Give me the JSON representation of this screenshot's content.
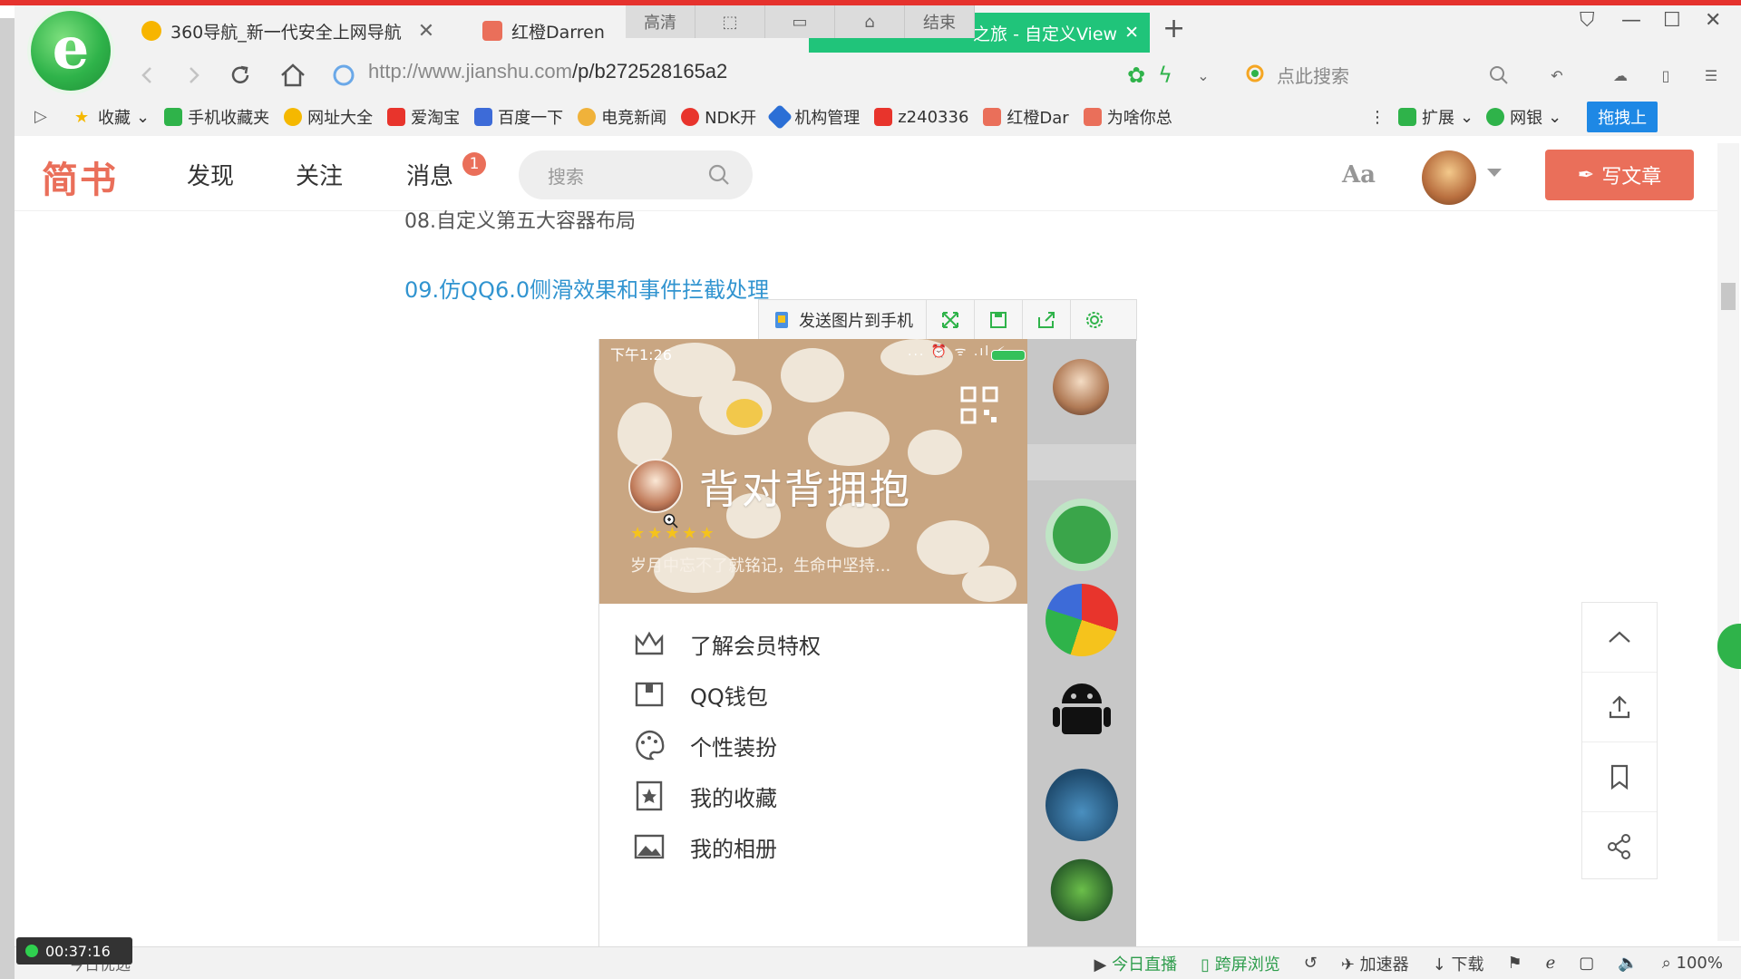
{
  "browser": {
    "tabs": [
      {
        "label": "360导航_新一代安全上网导航",
        "close": "✕"
      },
      {
        "label": "红橙Darren"
      }
    ],
    "overlay_tools": [
      "高清",
      "",
      "",
      "",
      "结束"
    ],
    "active_tab": {
      "label": "之旅 - 自定义View",
      "close": "✕"
    },
    "new_tab": "+",
    "url_host": "http://www.jianshu.com",
    "url_path": "/p/b272528165a2",
    "search_placeholder": "点此搜索",
    "bookmarks": [
      "收藏",
      "手机收藏夹",
      "网址大全",
      "爱淘宝",
      "百度一下",
      "电竞新闻",
      "NDK开",
      "机构管理",
      "z240336",
      "红橙Dar",
      "为啥你总"
    ],
    "bookmarks_right": {
      "extensions": "扩展",
      "netbank": "网银",
      "drag": "拖拽上"
    },
    "colors": {
      "accent": "#e5322d",
      "active_tab": "#20c47a"
    }
  },
  "site": {
    "brand": "简书",
    "nav": [
      "发现",
      "关注",
      "消息"
    ],
    "message_badge": "1",
    "search_placeholder": "搜索",
    "font_toggle": "Aa",
    "write_button": "写文章",
    "brand_color": "#ea6f5a"
  },
  "article": {
    "previous_item": "08.自定义第五大容器布局",
    "link": "09.仿QQ6.0侧滑效果和事件拦截处理"
  },
  "image_toolbar": {
    "send_to_phone": "发送图片到手机"
  },
  "phone": {
    "status_time": "下午1:26",
    "status_icons": "... ⏰ ᯤ .ıl ⚡",
    "username": "背对背拥抱",
    "stars": "★★★★★",
    "signature": "岁月中忘不了就铭记，生命中坚持...",
    "menu": [
      {
        "label": "了解会员特权",
        "icon": "crown-icon"
      },
      {
        "label": "QQ钱包",
        "icon": "wallet-icon"
      },
      {
        "label": "个性装扮",
        "icon": "palette-icon"
      },
      {
        "label": "我的收藏",
        "icon": "star-bookmark-icon"
      },
      {
        "label": "我的相册",
        "icon": "photo-icon"
      }
    ]
  },
  "status_bar": {
    "recording_time": "00:37:16",
    "today_pick": "今日优选",
    "live": "今日直播",
    "cross_screen": "跨屏浏览",
    "accelerator": "加速器",
    "download": "下载",
    "zoom": "100%"
  }
}
